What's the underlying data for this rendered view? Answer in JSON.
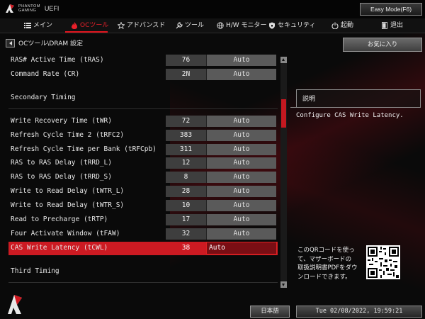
{
  "brand": {
    "line1": "PHANTOM",
    "line2": "GAMING",
    "uefi": "UEFI"
  },
  "easy_mode_button": "Easy Mode(F6)",
  "nav": [
    {
      "label": "メイン",
      "icon": "list-icon"
    },
    {
      "label": "OCツール",
      "icon": "flame-icon",
      "active": true
    },
    {
      "label": "アドバンスド",
      "icon": "star-icon"
    },
    {
      "label": "ツール",
      "icon": "wrench-icon"
    },
    {
      "label": "H/W モニター",
      "icon": "globe-icon"
    },
    {
      "label": "セキュリティ",
      "icon": "shield-icon"
    },
    {
      "label": "起動",
      "icon": "power-icon"
    },
    {
      "label": "退出",
      "icon": "exit-door-icon"
    }
  ],
  "breadcrumb": "OCツール\\DRAM 設定",
  "favorites_button": "お気に入り",
  "rows_top": [
    {
      "label": "RAS# Active Time (tRAS)",
      "value": "76",
      "option": "Auto"
    },
    {
      "label": "Command Rate (CR)",
      "value": "2N",
      "option": "Auto"
    }
  ],
  "section_secondary": "Secondary Timing",
  "rows_secondary": [
    {
      "label": "Write Recovery Time (tWR)",
      "value": "72",
      "option": "Auto"
    },
    {
      "label": "Refresh Cycle Time 2 (tRFC2)",
      "value": "383",
      "option": "Auto"
    },
    {
      "label": "Refresh Cycle Time per Bank (tRFCpb)",
      "value": "311",
      "option": "Auto"
    },
    {
      "label": "RAS to RAS Delay (tRRD_L)",
      "value": "12",
      "option": "Auto"
    },
    {
      "label": "RAS to RAS Delay (tRRD_S)",
      "value": "8",
      "option": "Auto"
    },
    {
      "label": "Write to Read Delay (tWTR_L)",
      "value": "28",
      "option": "Auto"
    },
    {
      "label": "Write to Read Delay (tWTR_S)",
      "value": "10",
      "option": "Auto"
    },
    {
      "label": "Read to Precharge (tRTP)",
      "value": "17",
      "option": "Auto"
    },
    {
      "label": "Four Activate Window (tFAW)",
      "value": "32",
      "option": "Auto"
    },
    {
      "label": "CAS Write Latency (tCWL)",
      "value": "38",
      "option": "Auto",
      "selected": true
    }
  ],
  "section_third": "Third Timing",
  "description": {
    "title": "説明",
    "text": "Configure CAS Write Latency."
  },
  "qr_help": [
    "このQRコードを使っ",
    "て、マザーボードの",
    "取扱説明書PDFをダウ",
    "ンロードできます。"
  ],
  "language_button": "日本語",
  "datetime": "Tue 02/08/2022, 19:59:21",
  "colors": {
    "accent": "#e0141e",
    "selected_row": "#cc1a22"
  }
}
